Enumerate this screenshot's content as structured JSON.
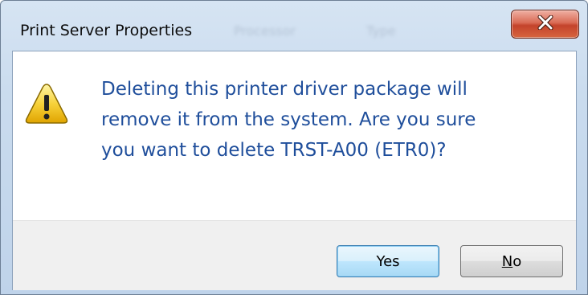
{
  "window": {
    "title": "Print Server Properties",
    "close_label": "X",
    "background_ghost": [
      "Processor",
      "Type"
    ]
  },
  "dialog": {
    "icon": "warning-triangle-icon",
    "message": "Deleting this printer driver package will\nremove it from the system. Are you sure\nyou want to delete TRST-A00 (ETR0)?",
    "message_color": "#1f4e9b"
  },
  "buttons": {
    "yes_label": "Yes",
    "no_label": "No",
    "no_accelerator": "N",
    "default": "yes"
  },
  "colors": {
    "close_button": "#c4432b",
    "default_button_border": "#3c7fb1",
    "footer": "#f0f0f0"
  }
}
